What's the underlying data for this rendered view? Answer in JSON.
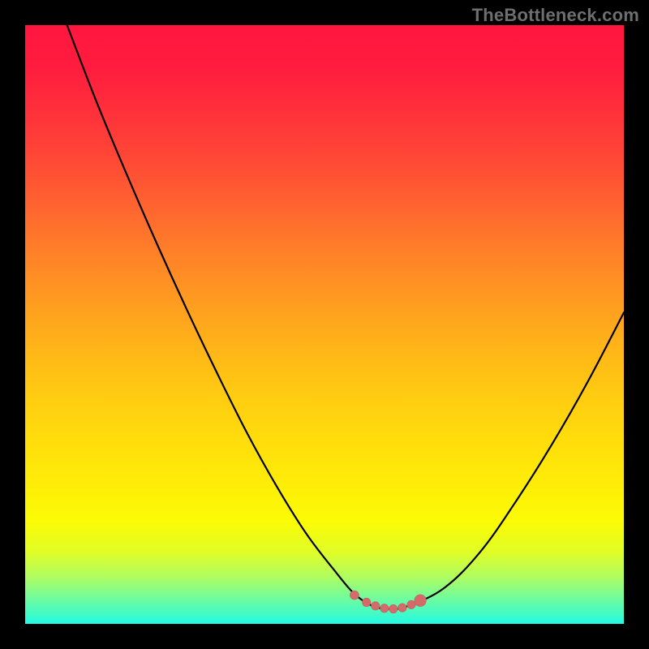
{
  "watermark": "TheBottleneck.com",
  "colors": {
    "page_bg": "#000000",
    "curve_stroke": "#000000",
    "marker_fill": "#d46a6a",
    "marker_stroke": "#c55e5e"
  },
  "chart_data": {
    "type": "line",
    "title": "",
    "xlabel": "",
    "ylabel": "",
    "xlim": [
      0,
      100
    ],
    "ylim": [
      0,
      100
    ],
    "grid": false,
    "series": [
      {
        "name": "bottleneck-curve",
        "x": [
          7,
          12,
          17,
          22,
          27,
          32,
          37,
          42,
          47,
          52,
          55,
          58,
          61,
          64,
          70,
          76,
          82,
          88,
          94,
          100
        ],
        "y": [
          100,
          87,
          75,
          63.5,
          52.5,
          42,
          32,
          23,
          15,
          8.5,
          5,
          3,
          2.5,
          3,
          6,
          12,
          20.5,
          30,
          40.5,
          52
        ]
      }
    ],
    "markers": {
      "name": "trough-markers",
      "x": [
        55,
        57,
        58.5,
        60,
        61.5,
        63,
        64.5,
        66
      ],
      "y": [
        4.8,
        3.6,
        3.0,
        2.6,
        2.5,
        2.7,
        3.2,
        3.9
      ],
      "radius_end_scale": 1.4
    }
  }
}
